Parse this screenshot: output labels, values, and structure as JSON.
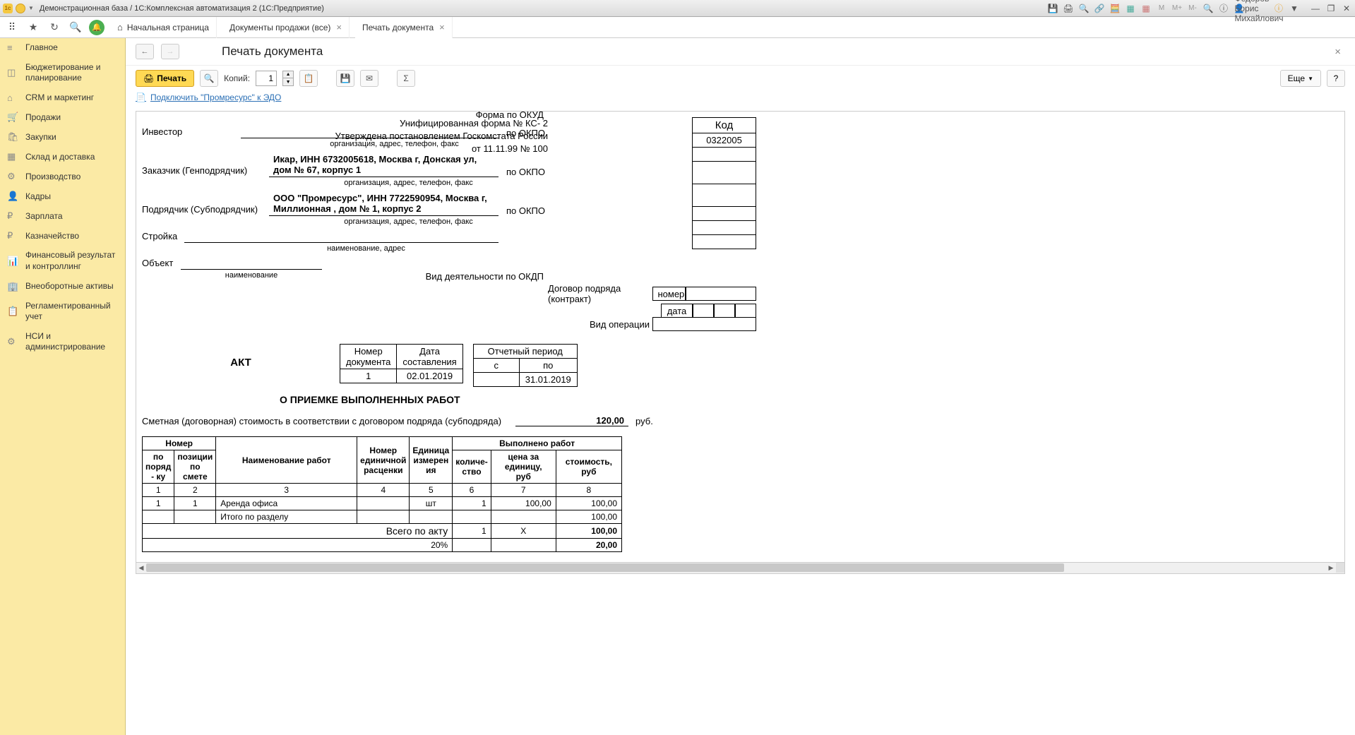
{
  "titlebar": {
    "title": "Демонстрационная база / 1С:Комплексная автоматизация 2 (1С:Предприятие)",
    "user": "Федоров Борис Михайлович",
    "m_labels": [
      "M",
      "M+",
      "M-"
    ]
  },
  "topbar": {
    "tabs": [
      {
        "label": "Начальная страница",
        "closable": false,
        "home": true
      },
      {
        "label": "Документы продажи (все)",
        "closable": true
      },
      {
        "label": "Печать документа",
        "closable": true,
        "active": true
      }
    ]
  },
  "sidebar": {
    "items": [
      {
        "icon": "≡",
        "label": "Главное"
      },
      {
        "icon": "◫",
        "label": "Бюджетирование и планирование"
      },
      {
        "icon": "⌂",
        "label": "CRM и маркетинг"
      },
      {
        "icon": "🛒",
        "label": "Продажи"
      },
      {
        "icon": "🛍",
        "label": "Закупки"
      },
      {
        "icon": "▦",
        "label": "Склад и доставка"
      },
      {
        "icon": "⚙",
        "label": "Производство"
      },
      {
        "icon": "👤",
        "label": "Кадры"
      },
      {
        "icon": "₽",
        "label": "Зарплата"
      },
      {
        "icon": "₽",
        "label": "Казначейство"
      },
      {
        "icon": "📊",
        "label": "Финансовый результат и контроллинг"
      },
      {
        "icon": "🏢",
        "label": "Внеоборотные активы"
      },
      {
        "icon": "📋",
        "label": "Регламентированный учет"
      },
      {
        "icon": "⚙",
        "label": "НСИ и администрирование"
      }
    ]
  },
  "content": {
    "title": "Печать документа",
    "toolbar": {
      "print": "Печать",
      "copies_label": "Копий:",
      "copies_value": "1",
      "more": "Еще"
    },
    "edo_link": "Подключить \"Промресурс\" к ЭДО"
  },
  "document": {
    "form_header_1": "Унифицированная форма № КС- 2",
    "form_header_2": "Утверждена постановлением Госкомстата России",
    "form_header_3": "от 11.11.99 № 100",
    "code_header": "Код",
    "code_okud_label": "Форма по ОКУД",
    "code_okud": "0322005",
    "investor_label": "Инвестор",
    "okpo_label": "по ОКПО",
    "customer_label": "Заказчик (Генподрядчик)",
    "customer_value": "Икар, ИНН 6732005618, Москва г, Донская ул, дом № 67, корпус 1",
    "contractor_label": "Подрядчик (Субподрядчик)",
    "contractor_value": "ООО \"Промресурс\", ИНН 7722590954, Москва г, Миллионная , дом № 1, корпус 2",
    "org_note": "организация, адрес, телефон, факс",
    "construction_label": "Стройка",
    "name_addr_note": "наименование, адрес",
    "object_label": "Объект",
    "name_note": "наименование",
    "okdp_label": "Вид деятельности по ОКДП",
    "contract_label": "Договор подряда (контракт)",
    "contract_num_label": "номер",
    "contract_date_label": "дата",
    "operation_label": "Вид операции",
    "doc_num_header": "Номер документа",
    "doc_date_header": "Дата составления",
    "doc_num": "1",
    "doc_date": "02.01.2019",
    "period_header": "Отчетный период",
    "period_from": "с",
    "period_to": "по",
    "period_to_val": "31.01.2019",
    "act_title": "АКТ",
    "act_sub": "О ПРИЕМКЕ ВЫПОЛНЕННЫХ РАБОТ",
    "estimate_text": "Сметная (договорная) стоимость в соответствии с договором подряда (субподряда)",
    "estimate_amount": "120,00",
    "estimate_currency": "руб.",
    "table": {
      "h_number": "Номер",
      "h_order": "по поряд - ку",
      "h_est_pos": "позиции по смете",
      "h_work_name": "Наименование работ",
      "h_unit_num": "Номер единичной расценки",
      "h_unit": "Единица измерен ия",
      "h_done": "Выполнено работ",
      "h_qty": "количе- ство",
      "h_price": "цена за единицу, руб",
      "h_cost": "стоимость,   руб",
      "cols": [
        "1",
        "2",
        "3",
        "4",
        "5",
        "6",
        "7",
        "8"
      ],
      "row1": {
        "n": "1",
        "pos": "1",
        "name": "Аренда офиса",
        "unit": "шт",
        "qty": "1",
        "price": "100,00",
        "cost": "100,00"
      },
      "subtotal_label": "Итого по разделу",
      "subtotal": "100,00",
      "total_label": "Всего по акту",
      "total_qty": "1",
      "total_x": "X",
      "total": "100,00",
      "pct_label": "20%",
      "pct_val": "20,00"
    }
  }
}
